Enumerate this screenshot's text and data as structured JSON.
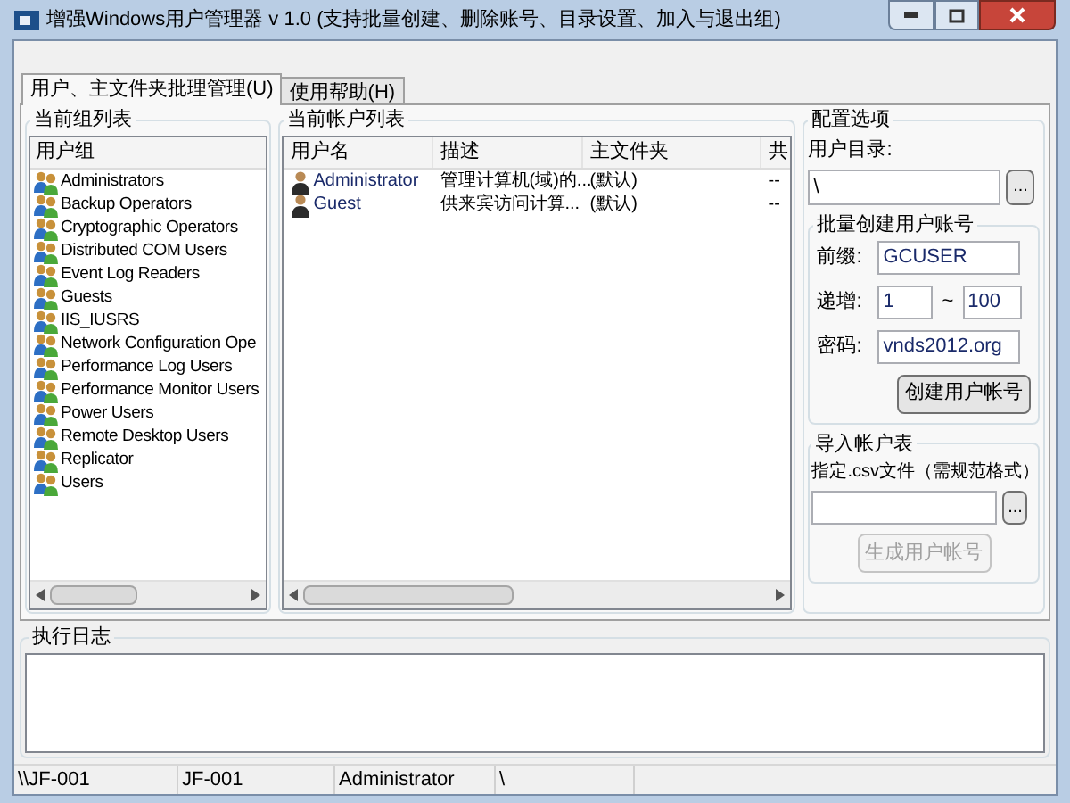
{
  "window": {
    "title": "增强Windows用户管理器 v 1.0 (支持批量创建、删除账号、目录设置、加入与退出组)"
  },
  "tabs": [
    {
      "label": "用户、主文件夹批理管理(U)",
      "selected": true
    },
    {
      "label": "使用帮助(H)",
      "selected": false
    }
  ],
  "groups_panel": {
    "title": "当前组列表",
    "column": "用户组",
    "items": [
      "Administrators",
      "Backup Operators",
      "Cryptographic Operators",
      "Distributed COM Users",
      "Event Log Readers",
      "Guests",
      "IIS_IUSRS",
      "Network Configuration Ope",
      "Performance Log Users",
      "Performance Monitor Users",
      "Power Users",
      "Remote Desktop Users",
      "Replicator",
      "Users"
    ]
  },
  "accounts_panel": {
    "title": "当前帐户列表",
    "columns": [
      "用户名",
      "描述",
      "主文件夹",
      "共"
    ],
    "rows": [
      [
        "Administrator",
        "管理计算机(域)的...",
        "(默认)",
        "--"
      ],
      [
        "Guest",
        "供来宾访问计算...",
        "(默认)",
        "--"
      ]
    ]
  },
  "config": {
    "title": "配置选项",
    "dir_label": "用户目录:",
    "dir_value": "\\",
    "browse": "...",
    "batch": {
      "title": "批量创建用户账号",
      "prefix_label": "前缀:",
      "prefix": "GCUSER",
      "range_label": "递增:",
      "from": "1",
      "sep": "~",
      "to": "100",
      "password_label": "密码:",
      "password": "vnds2012.org",
      "button": {
        "label": "创建用户帐号",
        "disabled": false
      }
    },
    "import": {
      "title": "导入帐户表",
      "hint": "指定.csv文件（需规范格式）",
      "browse": "...",
      "button": {
        "label": "生成用户帐号",
        "disabled": true
      }
    }
  },
  "log": {
    "title": "执行日志"
  },
  "status_bar": [
    "\\\\JF-001",
    "JF-001",
    "Administrator",
    "\\"
  ]
}
